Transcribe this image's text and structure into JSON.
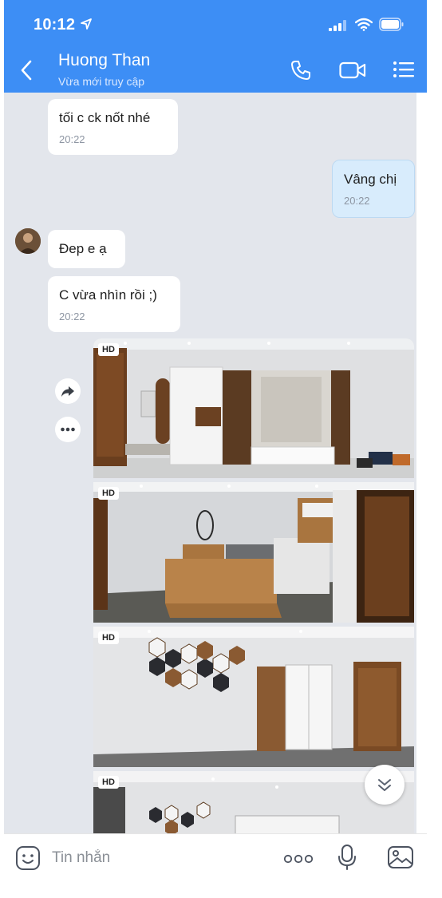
{
  "status_bar": {
    "time": "10:12"
  },
  "header": {
    "contact_name": "Huong Than",
    "contact_status": "Vừa mới truy cập"
  },
  "messages": [
    {
      "direction": "incoming",
      "text": "tối c ck nốt nhé",
      "time": "20:22"
    },
    {
      "direction": "outgoing",
      "text": "Vâng chị",
      "time": "20:22"
    },
    {
      "direction": "incoming",
      "text": "Đep e ạ",
      "time": ""
    },
    {
      "direction": "incoming",
      "text": "C vừa nhìn rồi ;)",
      "time": "20:22"
    }
  ],
  "photos": [
    {
      "badge": "HD",
      "icon": "living-room-photo"
    },
    {
      "badge": "HD",
      "icon": "bedroom-photo"
    },
    {
      "badge": "HD",
      "icon": "wardrobe-room-photo"
    },
    {
      "badge": "HD",
      "icon": "room-photo"
    }
  ],
  "input": {
    "placeholder": "Tin nhắn"
  },
  "colors": {
    "header": "#3d8ef5",
    "chat_bg": "#e3e6ec",
    "outgoing_bubble": "#d8ecfc"
  }
}
